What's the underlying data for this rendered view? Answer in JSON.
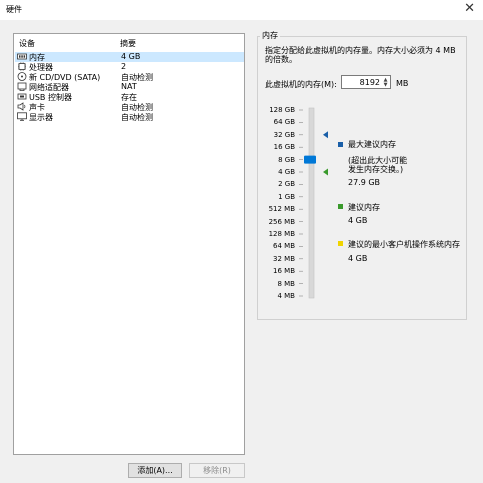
{
  "window": {
    "title": "硬件",
    "close_glyph": "✕"
  },
  "devices": {
    "col_device": "设备",
    "col_summary": "摘要",
    "rows": [
      {
        "name": "内存",
        "summary": "4 GB",
        "icon": "memory-icon",
        "selected": true
      },
      {
        "name": "处理器",
        "summary": "2",
        "icon": "processor-icon",
        "selected": false
      },
      {
        "name": "新 CD/DVD (SATA)",
        "summary": "自动检测",
        "icon": "cd-dvd-icon",
        "selected": false
      },
      {
        "name": "网络适配器",
        "summary": "NAT",
        "icon": "network-adapter-icon",
        "selected": false
      },
      {
        "name": "USB 控制器",
        "summary": "存在",
        "icon": "usb-icon",
        "selected": false
      },
      {
        "name": "声卡",
        "summary": "自动检测",
        "icon": "speaker-icon",
        "selected": false
      },
      {
        "name": "显示器",
        "summary": "自动检测",
        "icon": "monitor-icon",
        "selected": false
      }
    ]
  },
  "buttons": {
    "add": "添加(A)...",
    "remove": "移除(R)"
  },
  "memory": {
    "legend": "内存",
    "description_line1": "指定分配给此虚拟机的内存量。内存大小必须为 4 MB",
    "description_line2": "的倍数。",
    "field_label": "此虚拟机的内存(M):",
    "value": "8192",
    "unit": "MB",
    "scale": [
      "128 GB",
      "64 GB",
      "32 GB",
      "16 GB",
      "8 GB",
      "4 GB",
      "2 GB",
      "1 GB",
      "512 MB",
      "256 MB",
      "128 MB",
      "64 MB",
      "32 MB",
      "16 MB",
      "8 MB",
      "4 MB"
    ],
    "slider_level": "8 GB",
    "max_marker_level": "32 GB",
    "recommended_marker_level": "4 GB",
    "legend_items": [
      {
        "color": "#1a5fa8",
        "title": "最大建议内存",
        "note1": "(超出此大小可能",
        "note2": "发生内存交换。)",
        "value": "27.9 GB"
      },
      {
        "color": "#3a9a2c",
        "title": "建议内存",
        "value": "4 GB"
      },
      {
        "color": "#f0d400",
        "title": "建议的最小客户机操作系统内存",
        "value": "4 GB"
      }
    ]
  }
}
